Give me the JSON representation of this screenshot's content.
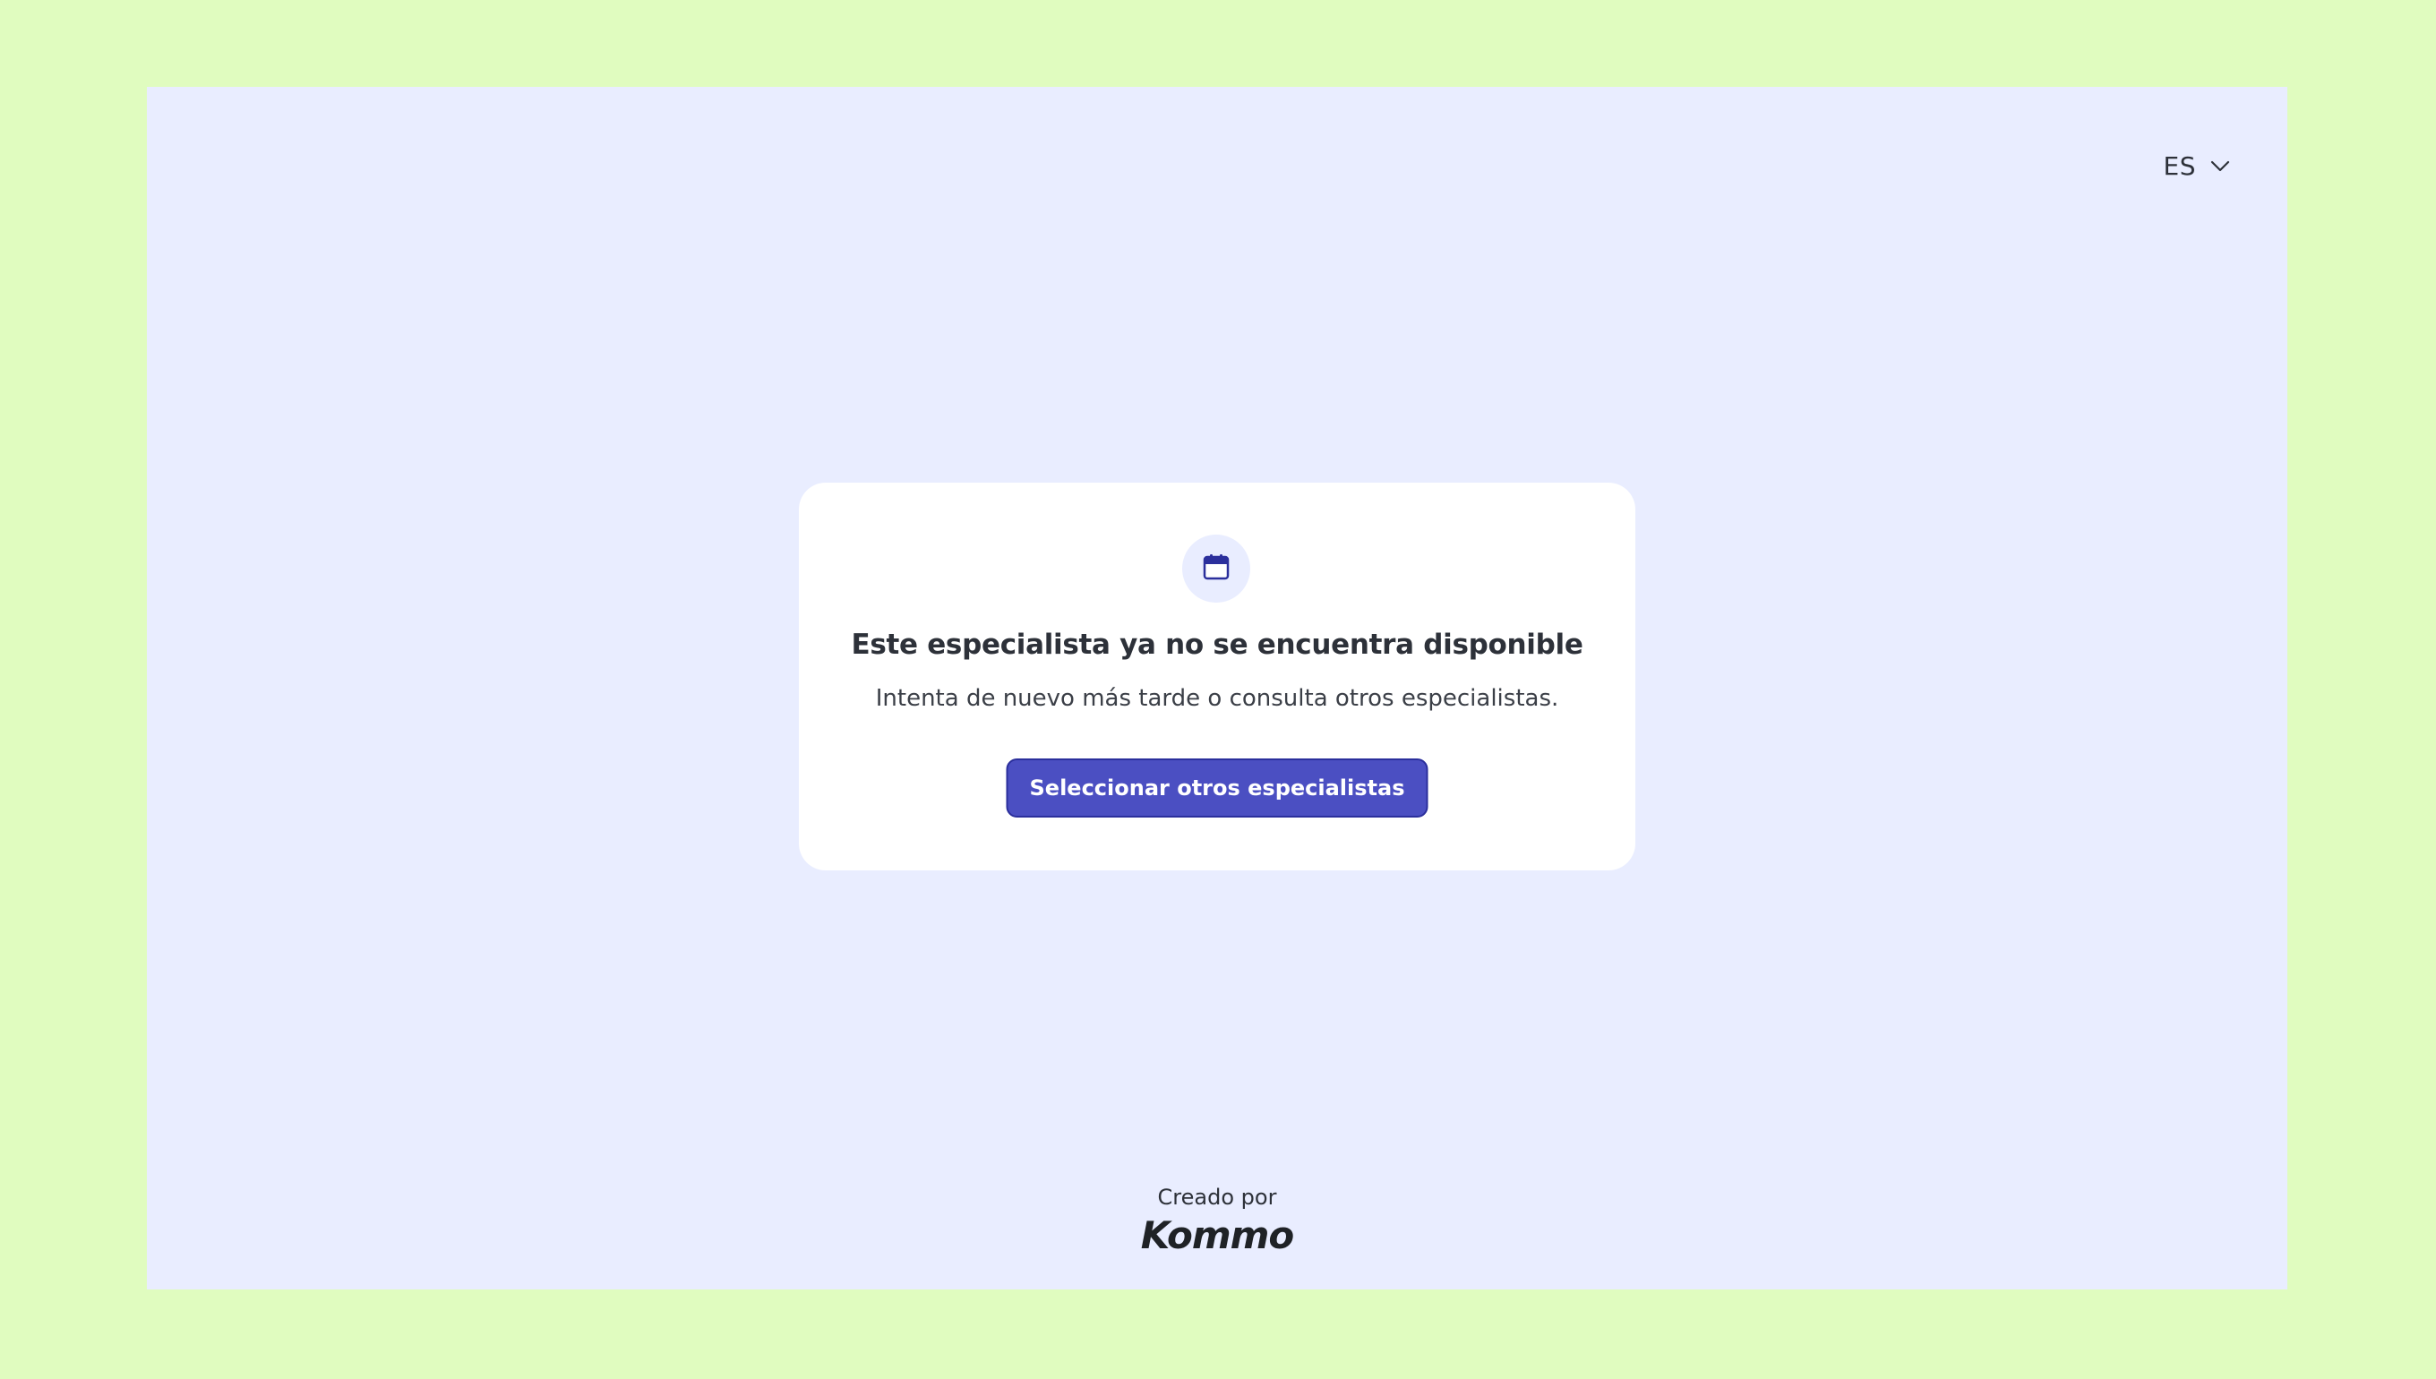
{
  "header": {
    "language": {
      "selected": "ES",
      "icon": "chevron-down-icon"
    }
  },
  "card": {
    "icon": "calendar-icon",
    "title": "Este especialista ya no se encuentra disponible",
    "subtitle": "Intenta de nuevo más tarde o consulta otros especialistas.",
    "button_label": "Seleccionar otros especialistas"
  },
  "footer": {
    "label": "Creado por",
    "brand": "Kommo"
  },
  "colors": {
    "outer_background": "#e0fcbf",
    "page_background": "#e9edff",
    "card_background": "#ffffff",
    "button_background": "#4b4fc2",
    "button_border": "#2b2f9c",
    "icon_color": "#2b2f9c",
    "text": "#2d3139"
  }
}
